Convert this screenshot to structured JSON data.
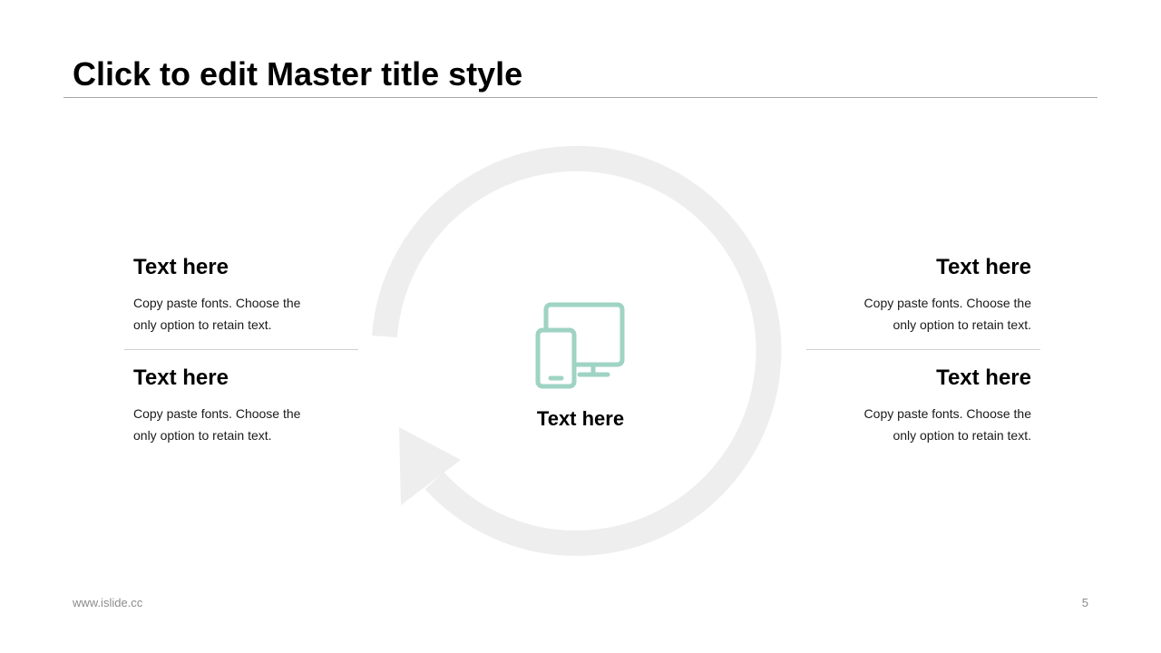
{
  "slide": {
    "title": "Click to edit Master title style",
    "center_label": "Text here",
    "accent_color": "#9fd3c3",
    "ring_color": "#eeeeee"
  },
  "blocks": [
    {
      "heading": "Text here",
      "body": "Copy paste fonts. Choose the only option to retain text."
    },
    {
      "heading": "Text here",
      "body": "Copy paste fonts. Choose the only option to retain text."
    },
    {
      "heading": "Text here",
      "body": "Copy paste fonts. Choose the only option to retain text."
    },
    {
      "heading": "Text here",
      "body": "Copy paste fonts. Choose the only option to retain text."
    }
  ],
  "footer": {
    "url": "www.islide.cc",
    "page_number": "5"
  }
}
